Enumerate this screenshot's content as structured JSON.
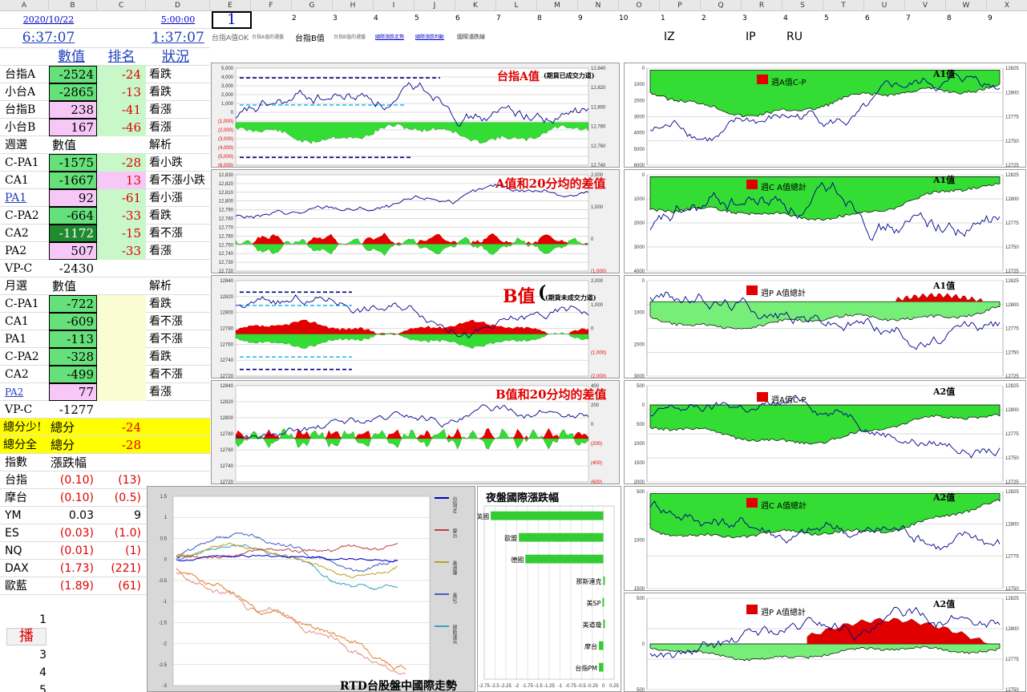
{
  "columns": [
    "A",
    "B",
    "C",
    "D",
    "E",
    "F",
    "G",
    "H",
    "I",
    "J",
    "K",
    "L",
    "M",
    "N",
    "O",
    "P",
    "Q",
    "R",
    "S",
    "T",
    "U",
    "V",
    "W",
    "X"
  ],
  "header": {
    "date": "2020/10/22",
    "time1": "5:00:00",
    "clock": "6:37:07",
    "timer": "1:37:07",
    "input_value": "1",
    "nums_top": [
      "2",
      "3",
      "4",
      "5",
      "6",
      "7",
      "8",
      "9",
      "10",
      "1",
      "2",
      "3",
      "4",
      "5",
      "6",
      "7",
      "8",
      "9"
    ],
    "links": [
      "台指A值OK",
      "台指A值的選盤",
      "台指B值",
      "台指B值的選盤",
      "國際漲跌走勢",
      "國際漲跌判斷",
      "國際漲跌線"
    ],
    "codes": [
      "IZ",
      "IP",
      "RU"
    ]
  },
  "main_table": {
    "headers": [
      "數值",
      "排名",
      "狀況"
    ],
    "rows": [
      {
        "a": "台指A",
        "b": "-2524",
        "c": "-24",
        "d": "看跌"
      },
      {
        "a": "小台A",
        "b": "-2865",
        "c": "-13",
        "d": "看跌"
      },
      {
        "a": "台指B",
        "b": "238",
        "c": "-41",
        "d": "看漲"
      },
      {
        "a": "小台B",
        "b": "167",
        "c": "-46",
        "d": "看漲"
      }
    ]
  },
  "weekly": {
    "label": "週選",
    "value_label": "數值",
    "analysis_label": "解析",
    "rows": [
      {
        "a": "C-PA1",
        "b": "-1575",
        "c": "-28",
        "d": "看小跌"
      },
      {
        "a": "CA1",
        "b": "-1667",
        "c": "13",
        "d": "看不漲小跌"
      },
      {
        "a": "PA1",
        "b": "92",
        "c": "-61",
        "d": "看小漲"
      },
      {
        "a": "C-PA2",
        "b": "-664",
        "c": "-33",
        "d": "看跌"
      },
      {
        "a": "CA2",
        "b": "-1172",
        "c": "-15",
        "d": "看不漲"
      },
      {
        "a": "PA2",
        "b": "507",
        "c": "-33",
        "d": "看漲"
      },
      {
        "a": "VP-C",
        "b": "-2430",
        "c": "",
        "d": ""
      }
    ]
  },
  "monthly": {
    "label": "月選",
    "value_label": "數值",
    "analysis_label": "解析",
    "rows": [
      {
        "a": "C-PA1",
        "b": "-722",
        "d": "看跌"
      },
      {
        "a": "CA1",
        "b": "-609",
        "d": "看不漲"
      },
      {
        "a": "PA1",
        "b": "-113",
        "d": "看不漲"
      },
      {
        "a": "C-PA2",
        "b": "-328",
        "d": "看跌"
      },
      {
        "a": "CA2",
        "b": "-499",
        "d": "看不漲"
      },
      {
        "a": "PA2",
        "b": "77",
        "d": "看漲"
      },
      {
        "a": "VP-C",
        "b": "-1277",
        "d": ""
      }
    ]
  },
  "totals": [
    {
      "a": "總分少!",
      "b": "總分",
      "c": "-24"
    },
    {
      "a": "總分全",
      "b": "總分",
      "c": "-28"
    }
  ],
  "index_table": {
    "headers": [
      "指數",
      "漲跌幅"
    ],
    "rows": [
      {
        "a": "台指",
        "b": "(0.10)",
        "c": "(13)",
        "neg": true
      },
      {
        "a": "摩台",
        "b": "(0.10)",
        "c": "(0.5)",
        "neg": true
      },
      {
        "a": "YM",
        "b": "0.03",
        "c": "9",
        "neg": false
      },
      {
        "a": "ES",
        "b": "(0.03)",
        "c": "(1.0)",
        "neg": true
      },
      {
        "a": "NQ",
        "b": "(0.01)",
        "c": "(1)",
        "neg": true
      },
      {
        "a": "DAX",
        "b": "(1.73)",
        "c": "(221)",
        "neg": true
      },
      {
        "a": "歐藍",
        "b": "(1.89)",
        "c": "(61)",
        "neg": true
      }
    ]
  },
  "bottom_left": {
    "n1": "1",
    "btn": "播",
    "n3": "3",
    "n4": "4",
    "n5": "5"
  },
  "charts": {
    "c1": {
      "title": "台指A值",
      "sub": "(期貨已成交力道)",
      "left_ticks": [
        "5,000",
        "4,000",
        "3,000",
        "2,000",
        "1,000",
        "0",
        "(1,000)",
        "(2,000)",
        "(3,000)",
        "(4,000)",
        "(5,000)",
        "(6,000)"
      ],
      "right_ticks": [
        "12,840",
        "12,820",
        "12,800",
        "12,780",
        "12,760",
        "12,740"
      ]
    },
    "c2": {
      "title": "A值和20分均的差值",
      "left_ticks": [
        "12,830",
        "12,820",
        "12,810",
        "12,800",
        "12,790",
        "12,780",
        "12,770",
        "12,760",
        "12,750",
        "12,740",
        "12,730",
        "12,720"
      ],
      "right_ticks": [
        "2,000",
        "1,000",
        "0",
        "(1,000)"
      ]
    },
    "c3": {
      "title": "B值",
      "paren": "(",
      "sub": "(期貨未成交力道)",
      "left_ticks": [
        "12840",
        "12820",
        "12800",
        "12780",
        "12760",
        "12740",
        "12720"
      ],
      "right_ticks": [
        "2,000",
        "1,000",
        "0",
        "(1,000)",
        "(2,000)"
      ]
    },
    "c4": {
      "title": "B值和20分均的差值",
      "left_ticks": [
        "12840",
        "12820",
        "12800",
        "12780",
        "12760",
        "12740",
        "12720"
      ],
      "right_ticks": [
        "400",
        "200",
        "0",
        "(200)",
        "(400)",
        "(600)"
      ]
    },
    "r1": {
      "label": "A1值",
      "legend": "週A值C-P",
      "left_ticks": [
        "0",
        "1000",
        "2000",
        "3000",
        "4000",
        "5000",
        "6000"
      ],
      "right_ticks": [
        "12825",
        "12800",
        "12775",
        "12750",
        "12725"
      ]
    },
    "r2": {
      "label": "A1值",
      "legend": "週C  A值總計",
      "left_ticks": [
        "0",
        "1000",
        "2000",
        "3000",
        "4000"
      ],
      "right_ticks": [
        "12825",
        "12800",
        "12775",
        "12750",
        "12725"
      ]
    },
    "r3": {
      "label": "A1值",
      "legend": "週P  A值總計",
      "left_ticks": [
        "0",
        "1000",
        "2000",
        "3000"
      ],
      "right_ticks": [
        "12825",
        "12800",
        "12775",
        "12750",
        "12725"
      ]
    },
    "r4": {
      "label": "A2值",
      "legend": "週A值C-P",
      "left_ticks": [
        "500",
        "0",
        "500",
        "1000",
        "1500",
        "2000"
      ],
      "right_ticks": [
        "12825",
        "12800",
        "12775",
        "12750",
        "12725"
      ]
    },
    "r5": {
      "label": "A2值",
      "legend": "週C  A值總計",
      "left_ticks": [
        "500",
        "1000",
        "1500"
      ],
      "right_ticks": [
        "12825",
        "12800",
        "12775",
        "12750"
      ]
    },
    "r6": {
      "label": "A2值",
      "legend": "週P  A值總計",
      "left_ticks": [
        "500",
        "0",
        "500"
      ],
      "right_ticks": [
        "12825",
        "12800",
        "12775",
        "12750"
      ]
    }
  },
  "intl_chart": {
    "title": "RTD台股盤中國際走勢",
    "y_ticks": [
      "1.5",
      "1",
      "0.5",
      "0",
      "-0.5",
      "-1",
      "-1.5",
      "-2",
      "-2.5",
      "-3"
    ],
    "legend": [
      "台指PM",
      "摩台",
      "美道瓊",
      "美SP",
      "那斯達克"
    ],
    "colors": {
      "taipm": "#0000c0",
      "motai": "#c04040",
      "dow": "#c0a020",
      "sp": "#4060c0",
      "nas": "#40a0c0"
    }
  },
  "night_chart": {
    "title": "夜盤國際漲跌幅",
    "bars": [
      {
        "label": "英國",
        "value": -2.6
      },
      {
        "label": "歐盟",
        "value": -1.95
      },
      {
        "label": "德國",
        "value": -1.8
      },
      {
        "label": "那斯達克",
        "value": 0.0
      },
      {
        "label": "美SP",
        "value": -0.02
      },
      {
        "label": "美道瓊",
        "value": 0.03
      },
      {
        "label": "摩台",
        "value": -0.1
      },
      {
        "label": "台指PM",
        "value": -0.1
      }
    ],
    "x_ticks": [
      "-2.75",
      "-2.5",
      "-2.25",
      "-2",
      "-1.75",
      "-1.5",
      "-1.25",
      "-1",
      "-0.75",
      "-0.5",
      "-0.25",
      "0",
      "0.25"
    ]
  }
}
